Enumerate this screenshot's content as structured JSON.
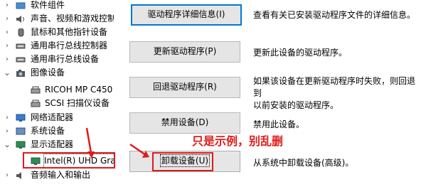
{
  "tree": {
    "items": [
      {
        "label": "软件组件",
        "chevron": "›"
      },
      {
        "label": "声音、视频和游戏控制",
        "chevron": "›"
      },
      {
        "label": "鼠标和其他指针设备",
        "chevron": "›"
      },
      {
        "label": "通用串行总线控制器",
        "chevron": "›"
      },
      {
        "label": "通用串行总线设备",
        "chevron": "›"
      },
      {
        "label": "图像设备",
        "chevron": "⌄"
      },
      {
        "label": "RICOH MP C450"
      },
      {
        "label": "SCSI 扫描仪设备"
      },
      {
        "label": "网络适配器",
        "chevron": "›"
      },
      {
        "label": "系统设备",
        "chevron": "›"
      },
      {
        "label": "显示适配器",
        "chevron": "⌄"
      },
      {
        "label": "Intel(R) UHD Gra"
      },
      {
        "label": "音频输入和输出",
        "chevron": "›"
      }
    ]
  },
  "actions": {
    "details_button": "驱动程序详细信息(I)",
    "details_desc": "查看有关已安装驱动程序文件的详细信息。",
    "update_button": "更新驱动程序(P)",
    "update_desc": "更新此设备的驱动程序。",
    "rollback_button": "回退驱动程序(R)",
    "rollback_desc_line1": "如果该设备在更新驱动程序时失败，则回退到",
    "rollback_desc_line2": "以前安装的驱动程序。",
    "disable_button": "禁用设备(D)",
    "disable_desc": "禁用此设备。",
    "uninstall_button": "卸载设备(U)",
    "uninstall_desc": "从系统中卸载设备(高级)。"
  },
  "annotation": {
    "text": "只是示例，别乱删",
    "color": "#e01b1b"
  }
}
